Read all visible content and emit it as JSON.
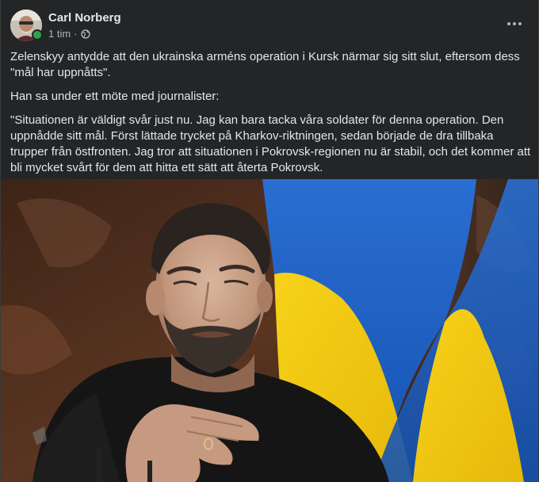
{
  "post": {
    "author": "Carl Norberg",
    "time": "1 tim",
    "separator": "·",
    "paragraphs": [
      "Zelenskyy antydde att den ukrainska arméns operation i Kursk närmar sig sitt slut, eftersom dess \"mål har uppnåtts\".",
      "Han sa under ett möte med journalister:",
      "\"Situationen är väldigt svår just nu. Jag kan bara tacka våra soldater för denna operation. Den uppnådde sitt mål. Först lättade trycket på Kharkov-riktningen, sedan började de dra tillbaka trupper från östfronten. Jag tror att situationen i Pokrovsk-regionen nu är stabil, och det kommer att bli mycket svårt för dem att hitta ett sätt att återta Pokrovsk."
    ]
  },
  "icons": {
    "audience": "globe-icon",
    "menu": "more-options-icon",
    "presence": "online-status-dot"
  },
  "colors": {
    "background": "#242526",
    "text": "#e4e6eb",
    "secondary_text": "#b0b3b8",
    "online": "#31a24c",
    "flag_blue": "#1b5fc2",
    "flag_yellow": "#f5cf12"
  }
}
